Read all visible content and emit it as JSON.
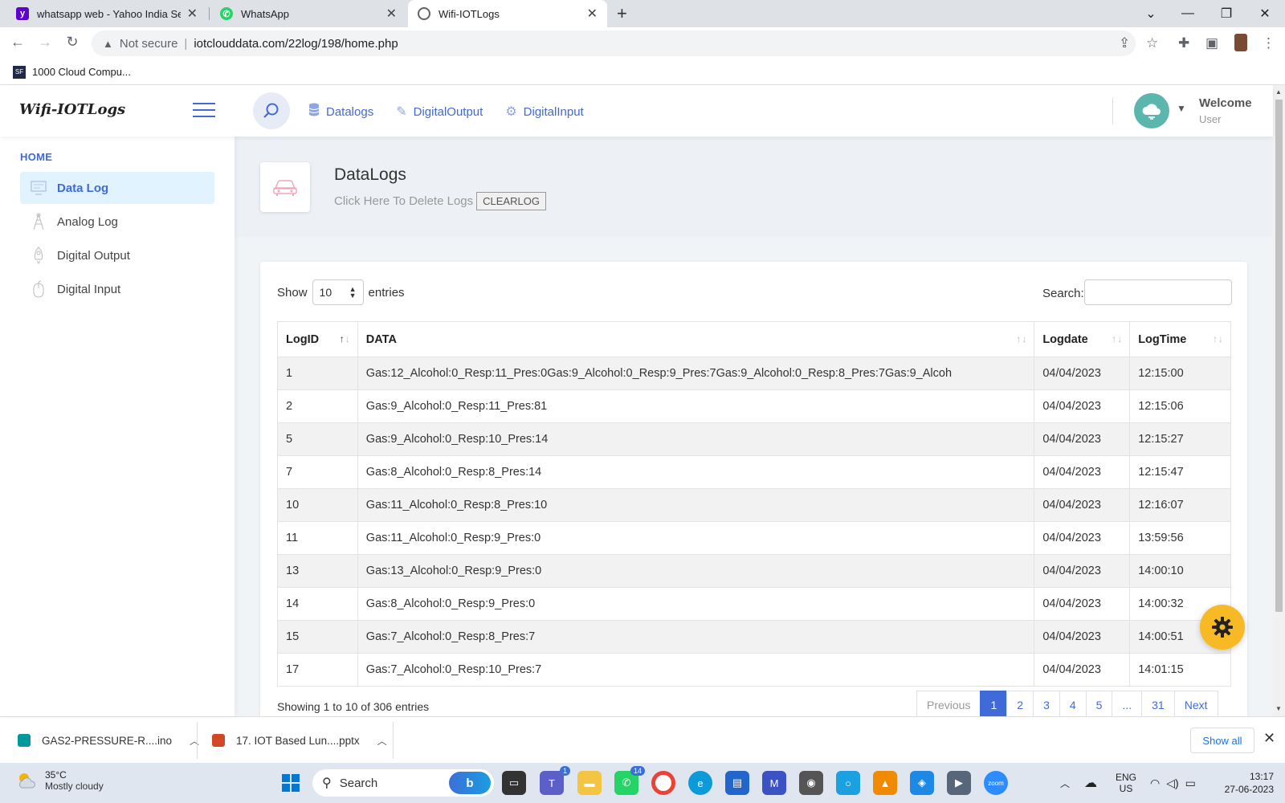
{
  "browser": {
    "tabs": [
      {
        "title": "whatsapp web - Yahoo India Sear",
        "favicon": "yahoo-icon",
        "color": "#5f01d1"
      },
      {
        "title": "WhatsApp",
        "favicon": "whatsapp-icon",
        "color": "#25d366"
      },
      {
        "title": "Wifi-IOTLogs",
        "favicon": "globe-icon",
        "color": "#5f6368"
      }
    ],
    "security": "Not secure",
    "url": "iotclouddata.com/22log/198/home.php",
    "bookmark": "1000 Cloud Compu..."
  },
  "header": {
    "brand": "Wifi-IOTLogs",
    "nav": [
      {
        "label": "Datalogs",
        "icon": "database-icon"
      },
      {
        "label": "DigitalOutput",
        "icon": "edit-icon"
      },
      {
        "label": "DigitalInput",
        "icon": "gear-icon"
      }
    ],
    "welcome": "Welcome",
    "user": "User"
  },
  "sidebar": {
    "heading": "HOME",
    "items": [
      {
        "label": "Data Log",
        "icon": "monitor-icon",
        "active": true
      },
      {
        "label": "Analog Log",
        "icon": "tower-icon"
      },
      {
        "label": "Digital Output",
        "icon": "rocket-icon"
      },
      {
        "label": "Digital Input",
        "icon": "mouse-icon"
      }
    ]
  },
  "page": {
    "title": "DataLogs",
    "subtitle": "Click Here To Delete Logs",
    "clear_button": "CLEARLOG"
  },
  "table": {
    "show_label": "Show",
    "entries_value": "10",
    "entries_label": "entries",
    "search_label": "Search:",
    "columns": [
      "LogID",
      "DATA",
      "Logdate",
      "LogTime"
    ],
    "rows": [
      [
        "1",
        "Gas:12_Alcohol:0_Resp:11_Pres:0Gas:9_Alcohol:0_Resp:9_Pres:7Gas:9_Alcohol:0_Resp:8_Pres:7Gas:9_Alcoh",
        "04/04/2023",
        "12:15:00"
      ],
      [
        "2",
        "Gas:9_Alcohol:0_Resp:11_Pres:81",
        "04/04/2023",
        "12:15:06"
      ],
      [
        "5",
        "Gas:9_Alcohol:0_Resp:10_Pres:14",
        "04/04/2023",
        "12:15:27"
      ],
      [
        "7",
        "Gas:8_Alcohol:0_Resp:8_Pres:14",
        "04/04/2023",
        "12:15:47"
      ],
      [
        "10",
        "Gas:11_Alcohol:0_Resp:8_Pres:10",
        "04/04/2023",
        "12:16:07"
      ],
      [
        "11",
        "Gas:11_Alcohol:0_Resp:9_Pres:0",
        "04/04/2023",
        "13:59:56"
      ],
      [
        "13",
        "Gas:13_Alcohol:0_Resp:9_Pres:0",
        "04/04/2023",
        "14:00:10"
      ],
      [
        "14",
        "Gas:8_Alcohol:0_Resp:9_Pres:0",
        "04/04/2023",
        "14:00:32"
      ],
      [
        "15",
        "Gas:7_Alcohol:0_Resp:8_Pres:7",
        "04/04/2023",
        "14:00:51"
      ],
      [
        "17",
        "Gas:7_Alcohol:0_Resp:10_Pres:7",
        "04/04/2023",
        "14:01:15"
      ]
    ],
    "showing": "Showing 1 to 10 of 306 entries",
    "pagination": [
      "Previous",
      "1",
      "2",
      "3",
      "4",
      "5",
      "...",
      "31",
      "Next"
    ]
  },
  "downloads": {
    "items": [
      {
        "name": "GAS2-PRESSURE-R....ino",
        "color": "#00979d"
      },
      {
        "name": "17. IOT Based Lun....pptx",
        "color": "#d24726"
      }
    ],
    "show_all": "Show all"
  },
  "taskbar": {
    "temperature": "35°C",
    "condition": "Mostly cloudy",
    "search": "Search",
    "teams_badge": "1",
    "whatsapp_badge": "14",
    "language": "ENG",
    "region": "US",
    "time": "13:17",
    "date": "27-06-2023"
  }
}
